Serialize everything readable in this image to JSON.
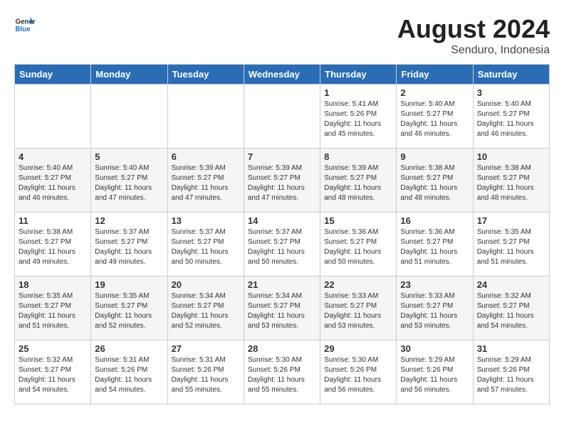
{
  "header": {
    "logo_line1": "General",
    "logo_line2": "Blue",
    "month_year": "August 2024",
    "location": "Senduro, Indonesia"
  },
  "days_of_week": [
    "Sunday",
    "Monday",
    "Tuesday",
    "Wednesday",
    "Thursday",
    "Friday",
    "Saturday"
  ],
  "weeks": [
    [
      {
        "day": "",
        "content": ""
      },
      {
        "day": "",
        "content": ""
      },
      {
        "day": "",
        "content": ""
      },
      {
        "day": "",
        "content": ""
      },
      {
        "day": "1",
        "content": "Sunrise: 5:41 AM\nSunset: 5:26 PM\nDaylight: 11 hours\nand 45 minutes."
      },
      {
        "day": "2",
        "content": "Sunrise: 5:40 AM\nSunset: 5:27 PM\nDaylight: 11 hours\nand 46 minutes."
      },
      {
        "day": "3",
        "content": "Sunrise: 5:40 AM\nSunset: 5:27 PM\nDaylight: 11 hours\nand 46 minutes."
      }
    ],
    [
      {
        "day": "4",
        "content": "Sunrise: 5:40 AM\nSunset: 5:27 PM\nDaylight: 11 hours\nand 46 minutes."
      },
      {
        "day": "5",
        "content": "Sunrise: 5:40 AM\nSunset: 5:27 PM\nDaylight: 11 hours\nand 47 minutes."
      },
      {
        "day": "6",
        "content": "Sunrise: 5:39 AM\nSunset: 5:27 PM\nDaylight: 11 hours\nand 47 minutes."
      },
      {
        "day": "7",
        "content": "Sunrise: 5:39 AM\nSunset: 5:27 PM\nDaylight: 11 hours\nand 47 minutes."
      },
      {
        "day": "8",
        "content": "Sunrise: 5:39 AM\nSunset: 5:27 PM\nDaylight: 11 hours\nand 48 minutes."
      },
      {
        "day": "9",
        "content": "Sunrise: 5:38 AM\nSunset: 5:27 PM\nDaylight: 11 hours\nand 48 minutes."
      },
      {
        "day": "10",
        "content": "Sunrise: 5:38 AM\nSunset: 5:27 PM\nDaylight: 11 hours\nand 48 minutes."
      }
    ],
    [
      {
        "day": "11",
        "content": "Sunrise: 5:38 AM\nSunset: 5:27 PM\nDaylight: 11 hours\nand 49 minutes."
      },
      {
        "day": "12",
        "content": "Sunrise: 5:37 AM\nSunset: 5:27 PM\nDaylight: 11 hours\nand 49 minutes."
      },
      {
        "day": "13",
        "content": "Sunrise: 5:37 AM\nSunset: 5:27 PM\nDaylight: 11 hours\nand 50 minutes."
      },
      {
        "day": "14",
        "content": "Sunrise: 5:37 AM\nSunset: 5:27 PM\nDaylight: 11 hours\nand 50 minutes."
      },
      {
        "day": "15",
        "content": "Sunrise: 5:36 AM\nSunset: 5:27 PM\nDaylight: 11 hours\nand 50 minutes."
      },
      {
        "day": "16",
        "content": "Sunrise: 5:36 AM\nSunset: 5:27 PM\nDaylight: 11 hours\nand 51 minutes."
      },
      {
        "day": "17",
        "content": "Sunrise: 5:35 AM\nSunset: 5:27 PM\nDaylight: 11 hours\nand 51 minutes."
      }
    ],
    [
      {
        "day": "18",
        "content": "Sunrise: 5:35 AM\nSunset: 5:27 PM\nDaylight: 11 hours\nand 51 minutes."
      },
      {
        "day": "19",
        "content": "Sunrise: 5:35 AM\nSunset: 5:27 PM\nDaylight: 11 hours\nand 52 minutes."
      },
      {
        "day": "20",
        "content": "Sunrise: 5:34 AM\nSunset: 5:27 PM\nDaylight: 11 hours\nand 52 minutes."
      },
      {
        "day": "21",
        "content": "Sunrise: 5:34 AM\nSunset: 5:27 PM\nDaylight: 11 hours\nand 53 minutes."
      },
      {
        "day": "22",
        "content": "Sunrise: 5:33 AM\nSunset: 5:27 PM\nDaylight: 11 hours\nand 53 minutes."
      },
      {
        "day": "23",
        "content": "Sunrise: 5:33 AM\nSunset: 5:27 PM\nDaylight: 11 hours\nand 53 minutes."
      },
      {
        "day": "24",
        "content": "Sunrise: 5:32 AM\nSunset: 5:27 PM\nDaylight: 11 hours\nand 54 minutes."
      }
    ],
    [
      {
        "day": "25",
        "content": "Sunrise: 5:32 AM\nSunset: 5:27 PM\nDaylight: 11 hours\nand 54 minutes."
      },
      {
        "day": "26",
        "content": "Sunrise: 5:31 AM\nSunset: 5:26 PM\nDaylight: 11 hours\nand 54 minutes."
      },
      {
        "day": "27",
        "content": "Sunrise: 5:31 AM\nSunset: 5:26 PM\nDaylight: 11 hours\nand 55 minutes."
      },
      {
        "day": "28",
        "content": "Sunrise: 5:30 AM\nSunset: 5:26 PM\nDaylight: 11 hours\nand 55 minutes."
      },
      {
        "day": "29",
        "content": "Sunrise: 5:30 AM\nSunset: 5:26 PM\nDaylight: 11 hours\nand 56 minutes."
      },
      {
        "day": "30",
        "content": "Sunrise: 5:29 AM\nSunset: 5:26 PM\nDaylight: 11 hours\nand 56 minutes."
      },
      {
        "day": "31",
        "content": "Sunrise: 5:29 AM\nSunset: 5:26 PM\nDaylight: 11 hours\nand 57 minutes."
      }
    ]
  ]
}
